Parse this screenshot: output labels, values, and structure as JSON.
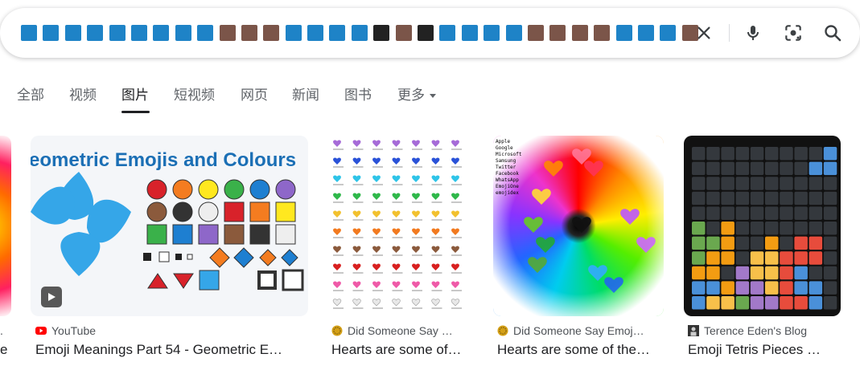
{
  "search": {
    "query_chip_colors": [
      "#1e83c7",
      "#1e83c7",
      "#1e83c7",
      "#1e83c7",
      "#1e83c7",
      "#1e83c7",
      "#1e83c7",
      "#1e83c7",
      "#1e83c7",
      "#7b5549",
      "#7b5549",
      "#7b5549",
      "#1e83c7",
      "#1e83c7",
      "#1e83c7",
      "#1e83c7",
      "#222222",
      "#7b5549",
      "#222222",
      "#1e83c7",
      "#1e83c7",
      "#1e83c7",
      "#1e83c7",
      "#7b5549",
      "#7b5549",
      "#7b5549",
      "#7b5549",
      "#1e83c7",
      "#1e83c7",
      "#1e83c7",
      "#7b5549"
    ],
    "icons": {
      "clear": "close-icon",
      "voice": "microphone-icon",
      "lens": "camera-lens-icon",
      "search": "search-icon"
    }
  },
  "tabs": [
    {
      "label": "全部"
    },
    {
      "label": "视频"
    },
    {
      "label": "图片",
      "active": true
    },
    {
      "label": "短视频"
    },
    {
      "label": "网页"
    },
    {
      "label": "新闻"
    },
    {
      "label": "图书"
    },
    {
      "label": "更多"
    }
  ],
  "results": [
    {
      "source": "YouTube",
      "title": "Emoji Meanings Part 54 - Geometric E…",
      "thumb_text": "eometric Emojis and Colours",
      "source_icon": "youtube-icon",
      "has_video": true
    },
    {
      "source": "Did Someone Say …",
      "title": "Hearts are some of…",
      "source_icon": "did-someone-say-favicon"
    },
    {
      "source": "Did Someone Say Emoj…",
      "title": "Hearts are some of the…",
      "source_icon": "did-someone-say-favicon",
      "platform_labels": [
        "Apple",
        "Google",
        "Microsoft",
        "Samsung",
        "Twitter",
        "Facebook",
        "WhatsApp",
        "EmojiOne",
        "emojidex"
      ]
    },
    {
      "source": "Terence Eden's Blog",
      "title": "Emoji Tetris Pieces …",
      "source_icon": "terence-eden-favicon"
    }
  ],
  "colors": {
    "accent": "#202124",
    "muted": "#5f6368",
    "youtube_red": "#ff0000"
  }
}
